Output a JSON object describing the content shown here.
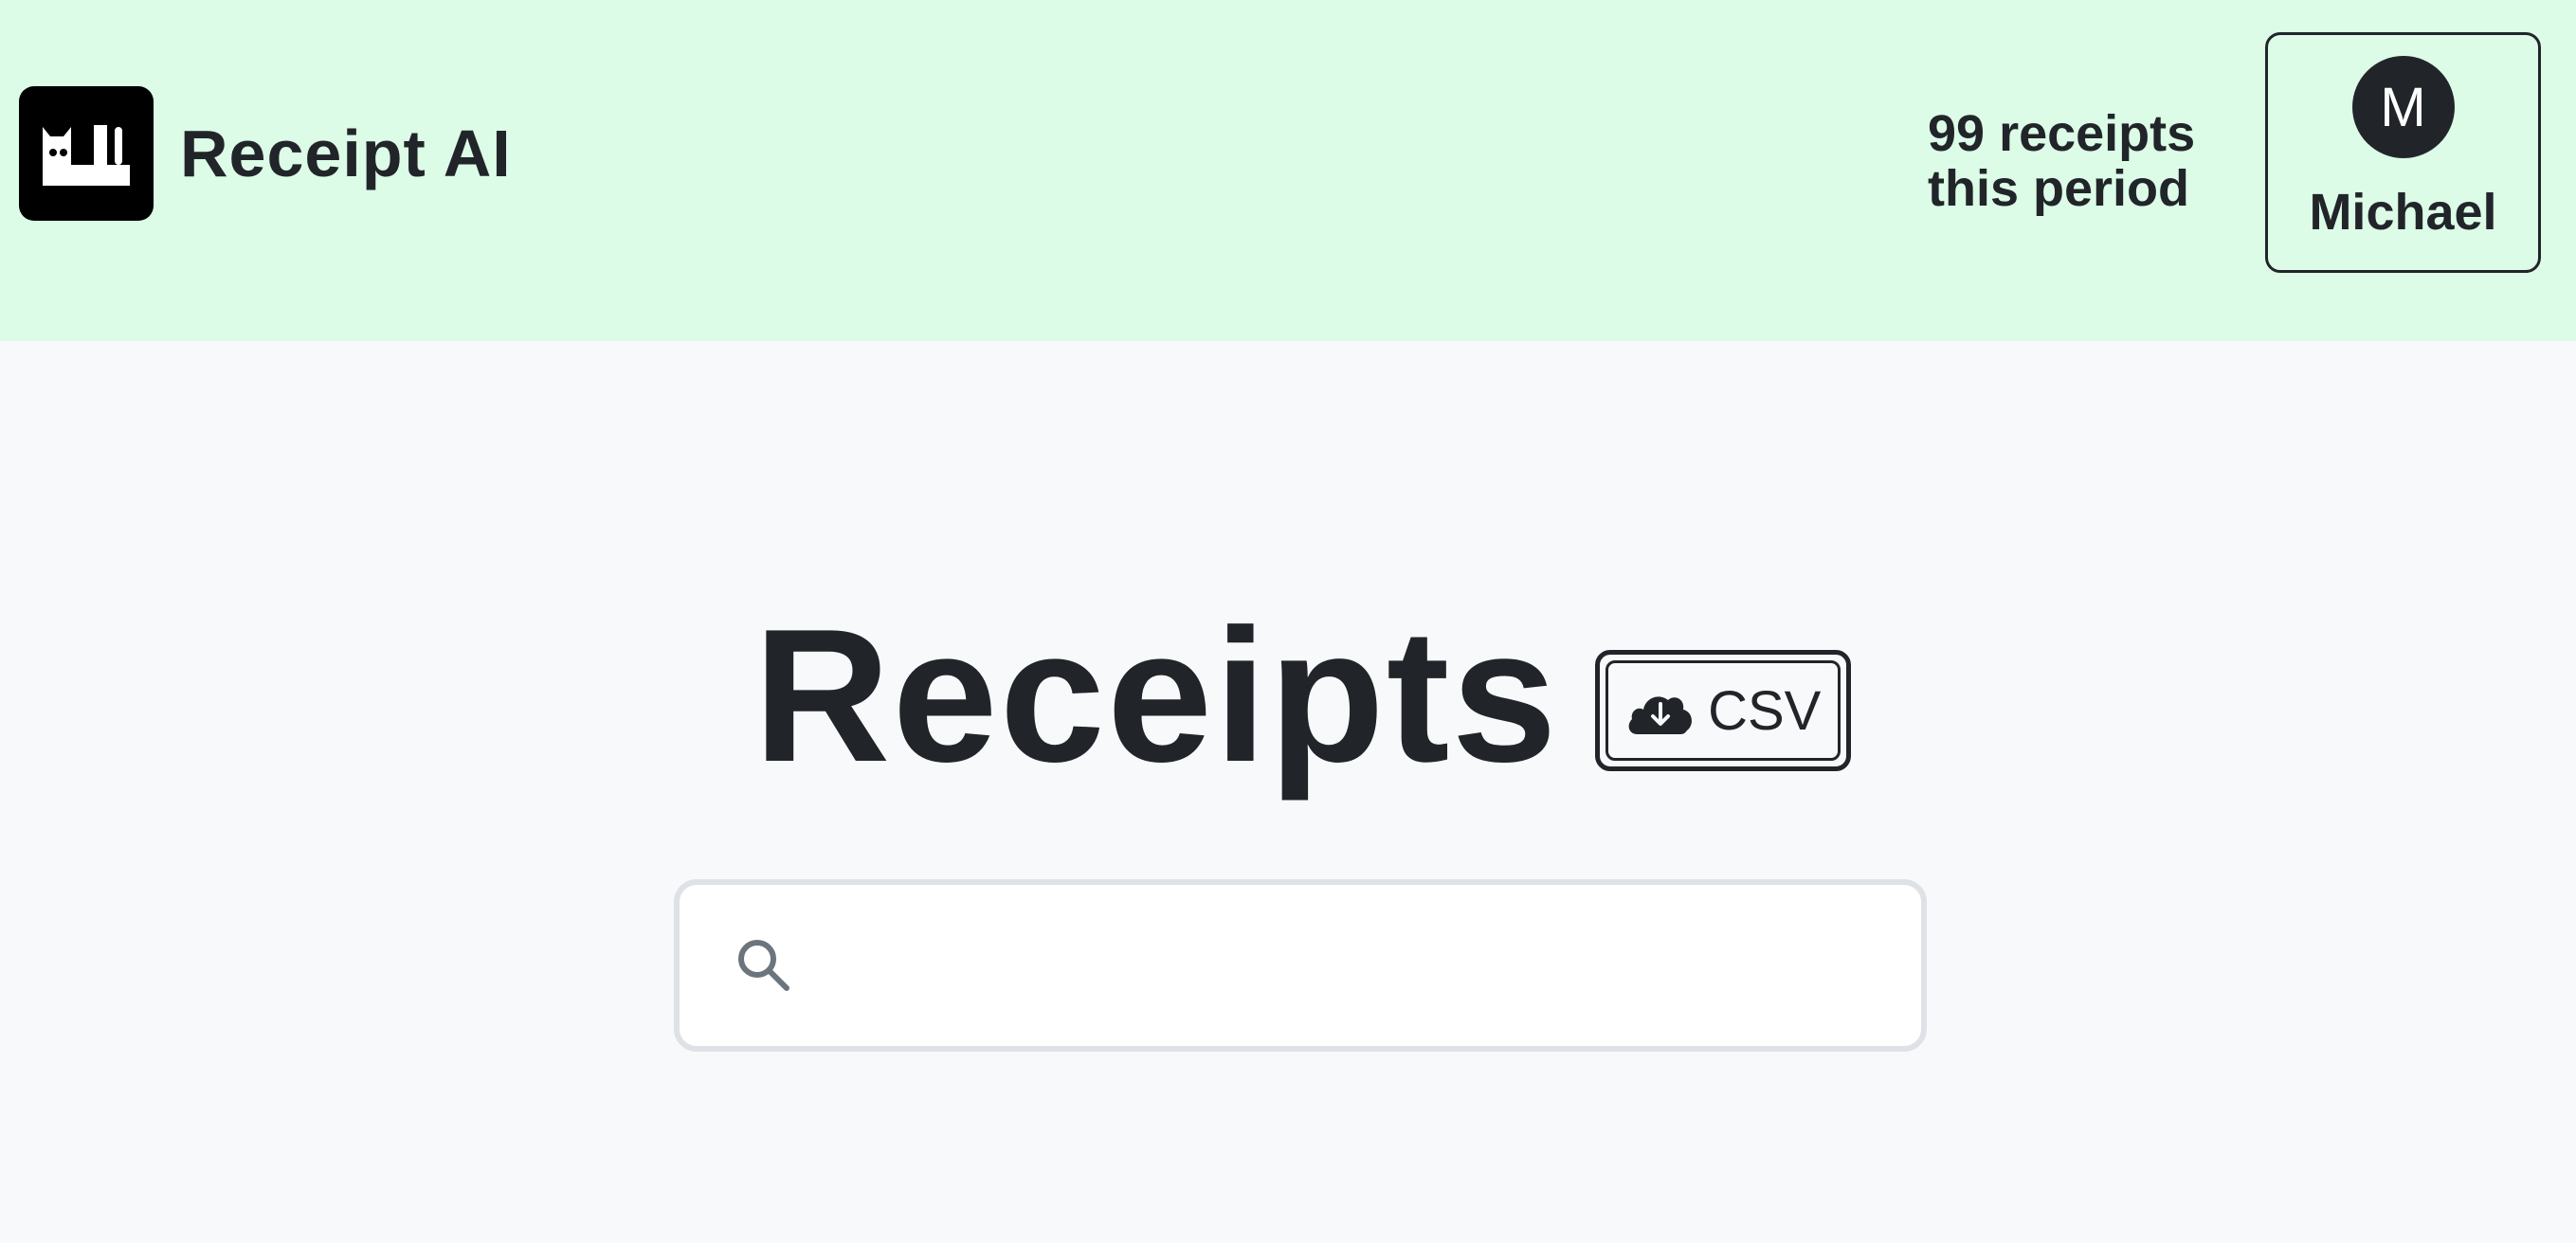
{
  "header": {
    "brand_name": "Receipt AI",
    "logo_icon": "cat-logo-icon",
    "receipt_count": "99 receipts this period",
    "user": {
      "initial": "M",
      "name": "Michael"
    }
  },
  "main": {
    "title": "Receipts",
    "csv_button": {
      "label": "CSV",
      "icon": "cloud-download-icon"
    },
    "search": {
      "value": "",
      "placeholder": "",
      "icon": "search-icon"
    }
  },
  "colors": {
    "header_bg": "#dcfce7",
    "page_bg": "#f8f9fb",
    "text": "#212529",
    "search_border": "#dee2e6",
    "search_icon": "#6c757d"
  }
}
